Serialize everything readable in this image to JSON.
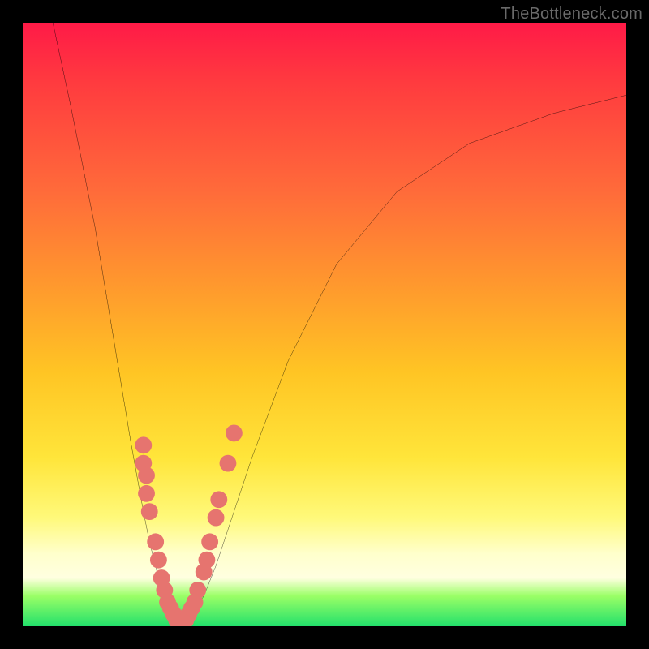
{
  "watermark": "TheBottleneck.com",
  "colors": {
    "frame": "#000000",
    "gradient_top": "#ff1a47",
    "gradient_mid": "#ffe53a",
    "gradient_band": "#ffffcc",
    "gradient_bottom": "#22e06b",
    "curve": "#000000",
    "marker": "#e6746f"
  },
  "chart_data": {
    "type": "line",
    "title": "",
    "xlabel": "",
    "ylabel": "",
    "xlim": [
      0,
      100
    ],
    "ylim": [
      0,
      100
    ],
    "curve": {
      "note": "V-shaped bottleneck curve; y estimated from gradient position (0=bottom/green, 100=top/red)",
      "x": [
        5,
        8,
        12,
        16,
        18,
        20,
        21,
        22,
        23,
        24,
        25,
        26,
        27,
        28,
        30,
        32,
        34,
        38,
        44,
        52,
        62,
        74,
        88,
        100
      ],
      "y": [
        100,
        86,
        66,
        42,
        30,
        19,
        14,
        10,
        6,
        3,
        2,
        1,
        1,
        2,
        5,
        10,
        16,
        28,
        44,
        60,
        72,
        80,
        85,
        88
      ]
    },
    "markers": {
      "note": "pink/coral circular markers clustered near the bottom of the V",
      "points": [
        [
          20,
          30
        ],
        [
          20,
          27
        ],
        [
          20.5,
          25
        ],
        [
          20.5,
          22
        ],
        [
          21,
          19
        ],
        [
          22,
          14
        ],
        [
          22.5,
          11
        ],
        [
          23,
          8
        ],
        [
          23.5,
          6
        ],
        [
          24,
          4
        ],
        [
          24.5,
          3
        ],
        [
          25,
          2
        ],
        [
          25.5,
          1
        ],
        [
          26,
          1
        ],
        [
          26.5,
          1
        ],
        [
          27,
          1
        ],
        [
          27.5,
          2
        ],
        [
          28,
          3
        ],
        [
          28.5,
          4
        ],
        [
          29,
          6
        ],
        [
          30,
          9
        ],
        [
          30.5,
          11
        ],
        [
          31,
          14
        ],
        [
          32,
          18
        ],
        [
          32.5,
          21
        ],
        [
          34,
          27
        ],
        [
          35,
          32
        ]
      ],
      "r": 1.4
    }
  }
}
